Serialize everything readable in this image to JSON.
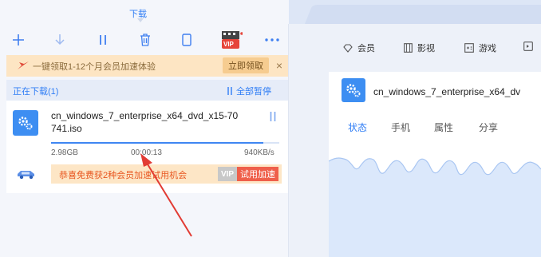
{
  "tabs": {
    "download_label": "下载"
  },
  "toolbar": {
    "buttons": [
      "plus-icon",
      "download-arrow-icon",
      "pause-icon",
      "trash-icon",
      "phone-icon",
      "vip-video-icon",
      "more-icon"
    ],
    "vip_badge_label": "VIP"
  },
  "promo": {
    "text": "一键领取1-12个月会员加速体验",
    "claim_label": "立即领取",
    "close_label": "×"
  },
  "downloading": {
    "header": "正在下载(1)",
    "pause_all_label": "全部暂停"
  },
  "task": {
    "filename": "cn_windows_7_enterprise_x64_dvd_x15-70741.iso",
    "size": "2.98GB",
    "elapsed": "00:00:13",
    "speed": "940KB/s",
    "progress": 0.93,
    "vip_offer": "恭喜免费获2种会员加速试用机会",
    "vip_badge": "VIP",
    "vip_trial_label": "试用加速"
  },
  "right_nav": {
    "items": [
      {
        "icon": "diamond-icon",
        "label": "会员"
      },
      {
        "icon": "film-icon",
        "label": "影视"
      },
      {
        "icon": "gamepad-icon",
        "label": "游戏"
      },
      {
        "icon": "app-icon",
        "label": ""
      }
    ]
  },
  "detail": {
    "filename": "cn_windows_7_enterprise_x64_dv",
    "tabs": [
      "状态",
      "手机",
      "属性",
      "分享"
    ],
    "active_tab": 0
  },
  "colors": {
    "accent": "#2f7df5",
    "promo_bg": "#fde5c3",
    "vip_red": "#ef5f4a",
    "annotation_red": "#e23b33"
  }
}
